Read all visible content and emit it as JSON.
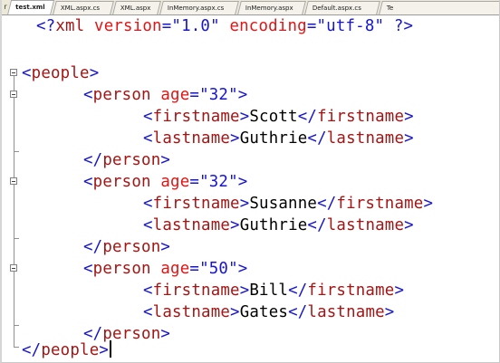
{
  "tabs": [
    {
      "label": "test.xml",
      "active": true
    },
    {
      "label": "XML.aspx.cs",
      "active": false
    },
    {
      "label": "XML.aspx",
      "active": false
    },
    {
      "label": "InMemory.aspx.cs",
      "active": false
    },
    {
      "label": "InMemory.aspx",
      "active": false
    },
    {
      "label": "Default.aspx.cs",
      "active": false
    },
    {
      "label": "Te",
      "active": false
    }
  ],
  "tab_overflow_glyph": "r",
  "code": {
    "decl": {
      "open": "<?",
      "name": "xml",
      "attr1": "version",
      "eq1": "=",
      "val1": "\"1.0\"",
      "attr2": "encoding",
      "eq2": "=",
      "val2": "\"utf-8\"",
      "close": "?>"
    },
    "people_open": {
      "open": "<",
      "name": "people",
      "close": ">"
    },
    "persons": [
      {
        "open": "<",
        "name": "person",
        "attr": "age",
        "eq": "=",
        "val": "\"32\"",
        "close": ">",
        "firstname": {
          "tag": "firstname",
          "text": "Scott"
        },
        "lastname": {
          "tag": "lastname",
          "text": "Guthrie"
        },
        "end": "person"
      },
      {
        "open": "<",
        "name": "person",
        "attr": "age",
        "eq": "=",
        "val": "\"32\"",
        "close": ">",
        "firstname": {
          "tag": "firstname",
          "text": "Susanne"
        },
        "lastname": {
          "tag": "lastname",
          "text": "Guthrie"
        },
        "end": "person"
      },
      {
        "open": "<",
        "name": "person",
        "attr": "age",
        "eq": "=",
        "val": "\"50\"",
        "close": ">",
        "firstname": {
          "tag": "firstname",
          "text": "Bill"
        },
        "lastname": {
          "tag": "lastname",
          "text": "Gates"
        },
        "end": "person"
      }
    ],
    "people_close": {
      "open": "</",
      "name": "people",
      "close": ">"
    },
    "lt": "<",
    "lt_slash": "</",
    "gt": ">"
  },
  "colors": {
    "delimiter": "#1515d0",
    "element": "#a31515",
    "attribute": "#e21414",
    "attribute_value": "#1515d0",
    "text": "#000000"
  },
  "icons": {
    "outline_collapse": "minus-box-icon"
  }
}
